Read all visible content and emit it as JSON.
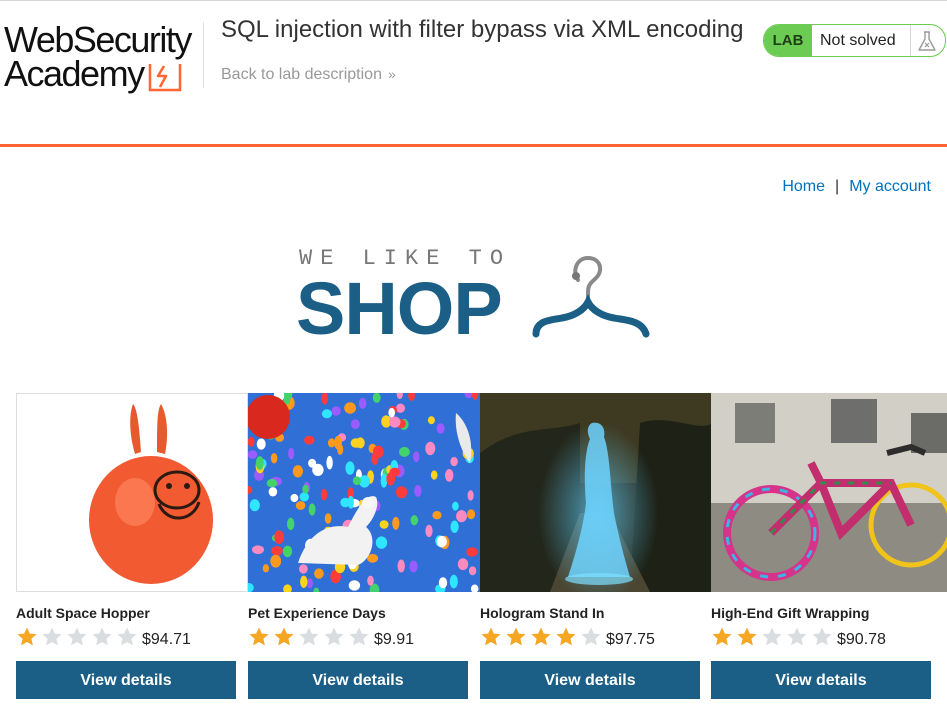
{
  "header": {
    "logo_line1": "WebSecurity",
    "logo_line2": "Academy",
    "lab_title": "SQL injection with filter bypass via XML encoding",
    "back_link": "Back to lab description",
    "status_badge": "LAB",
    "status_text": "Not solved"
  },
  "nav": {
    "home": "Home",
    "separator": "|",
    "account": "My account"
  },
  "banner": {
    "tagline": "WE LIKE TO",
    "word": "SHOP"
  },
  "colors": {
    "accent_orange": "#ff6633",
    "brand_blue": "#1b5f87",
    "lab_green": "#6bcb52",
    "link_blue": "#0071bc",
    "star_gold": "#f5a623"
  },
  "products": [
    {
      "name": "Adult Space Hopper",
      "price": "$94.71",
      "rating": 1,
      "button": "View details",
      "image": "orange-space-hopper"
    },
    {
      "name": "Pet Experience Days",
      "price": "$9.91",
      "rating": 2,
      "button": "View details",
      "image": "dog-with-balloons"
    },
    {
      "name": "Hologram Stand In",
      "price": "$97.75",
      "rating": 4,
      "button": "View details",
      "image": "blue-hologram-woman"
    },
    {
      "name": "High-End Gift Wrapping",
      "price": "$90.78",
      "rating": 2,
      "button": "View details",
      "image": "knitted-bicycle"
    }
  ]
}
